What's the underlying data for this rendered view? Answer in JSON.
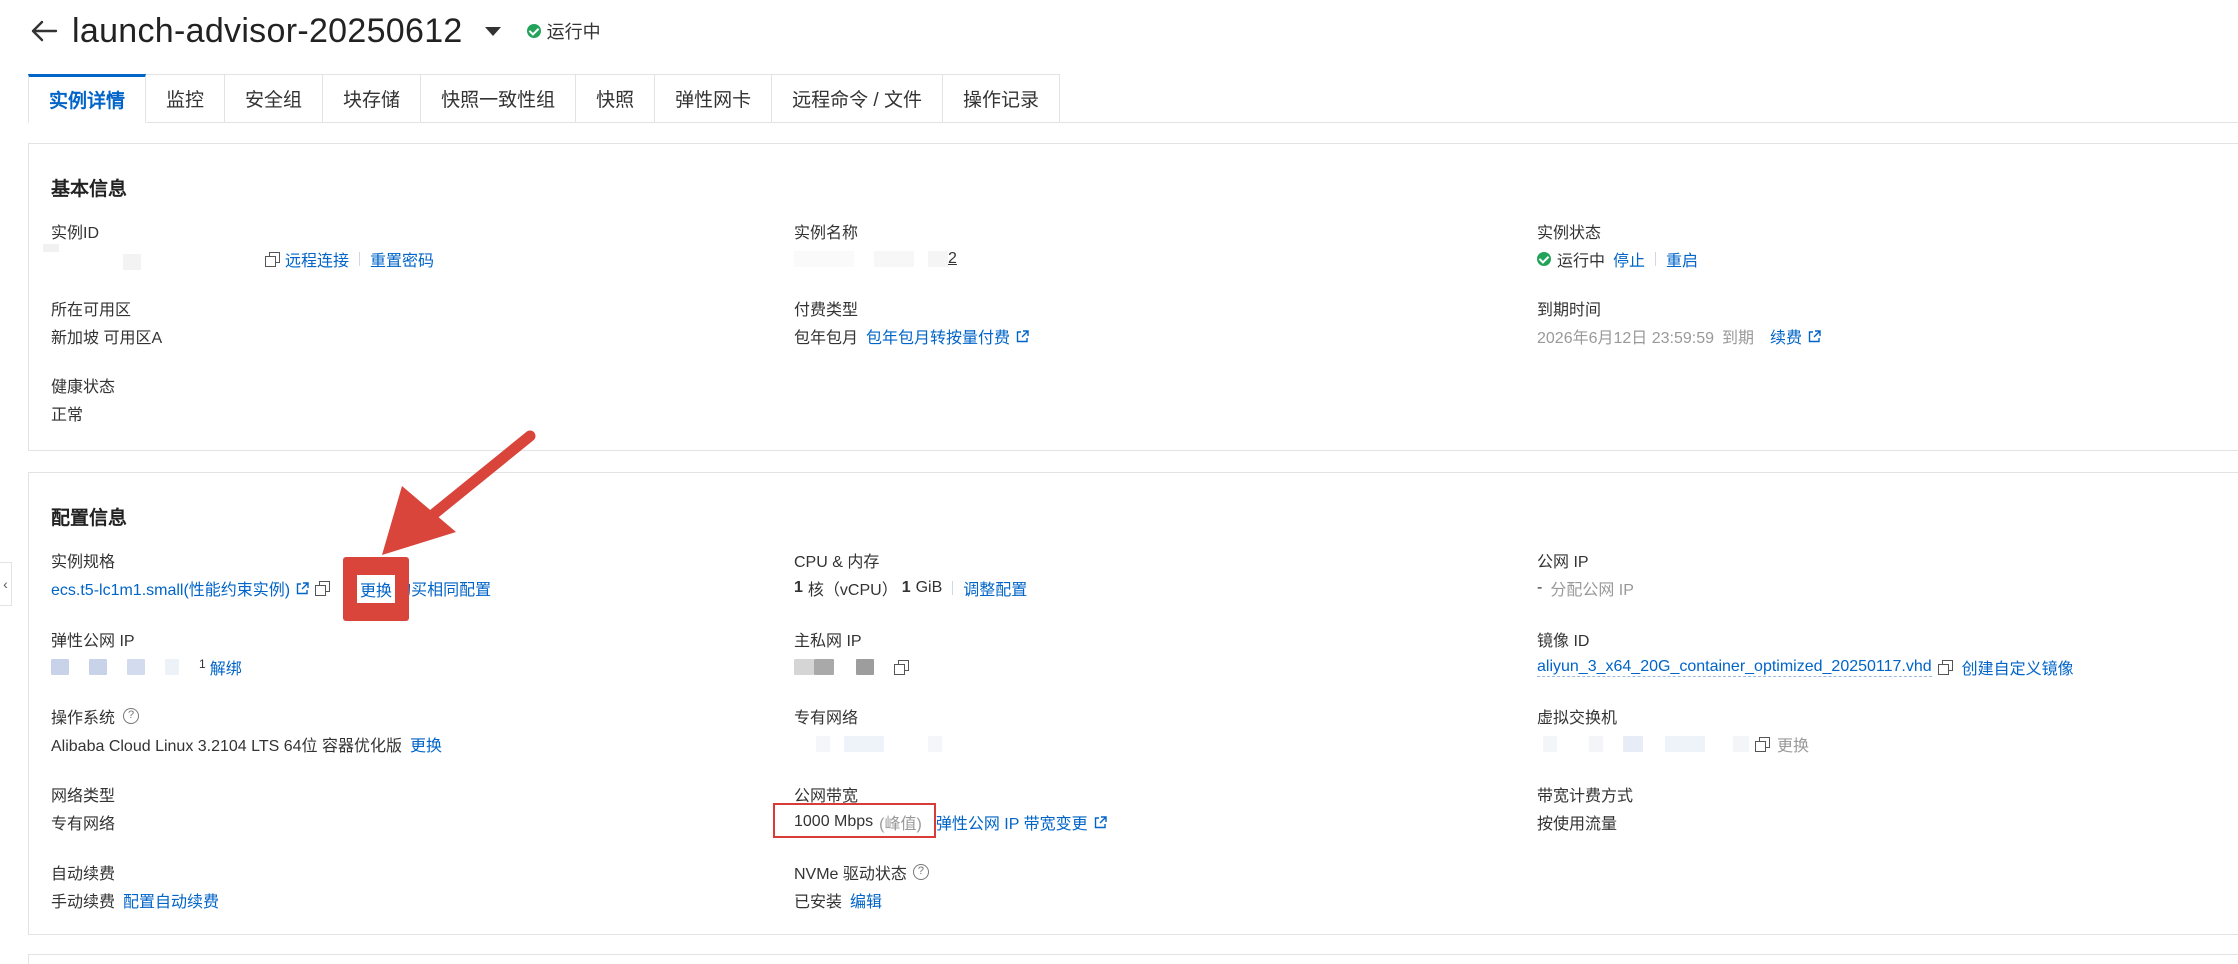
{
  "header": {
    "title": "launch-advisor-20250612",
    "status": "运行中"
  },
  "tabs": [
    "实例详情",
    "监控",
    "安全组",
    "块存储",
    "快照一致性组",
    "快照",
    "弹性网卡",
    "远程命令 / 文件",
    "操作记录"
  ],
  "basic": {
    "title": "基本信息",
    "instance_id_label": "实例ID",
    "remote_connect": "远程连接",
    "reset_password": "重置密码",
    "instance_name_label": "实例名称",
    "instance_name_suffix": "2",
    "instance_status_label": "实例状态",
    "instance_status": "运行中",
    "stop": "停止",
    "restart": "重启",
    "zone_label": "所在可用区",
    "zone": "新加坡 可用区A",
    "billing_label": "付费类型",
    "billing": "包年包月",
    "billing_switch": "包年包月转按量付费",
    "expire_label": "到期时间",
    "expire_time": "2026年6月12日 23:59:59",
    "expire_suffix": "到期",
    "renew": "续费",
    "health_label": "健康状态",
    "health": "正常"
  },
  "config": {
    "title": "配置信息",
    "spec_label": "实例规格",
    "spec": "ecs.t5-lc1m1.small(性能约束实例)",
    "change": "更换",
    "buy_same": "购买相同配置",
    "cpu_label": "CPU & 内存",
    "cpu_num": "1",
    "cpu_unit": "核（vCPU）",
    "mem_num": "1",
    "mem_unit": "GiB",
    "adjust": "调整配置",
    "public_ip_label": "公网 IP",
    "public_ip": "-",
    "assign_ip": "分配公网 IP",
    "eip_label": "弹性公网 IP",
    "eip_suffix": "1",
    "unbind": "解绑",
    "private_ip_label": "主私网 IP",
    "image_label": "镜像 ID",
    "image": "aliyun_3_x64_20G_container_optimized_20250117.vhd",
    "create_image": "创建自定义镜像",
    "os_label": "操作系统",
    "os": "Alibaba Cloud Linux 3.2104 LTS 64位 容器优化版",
    "os_change": "更换",
    "vpc_label": "专有网络",
    "vswitch_label": "虚拟交换机",
    "vswitch_change": "更换",
    "network_type_label": "网络类型",
    "network_type": "专有网络",
    "bandwidth_label": "公网带宽",
    "bandwidth": "1000 Mbps",
    "bandwidth_note": "(峰值)",
    "bandwidth_change": "弹性公网 IP 带宽变更",
    "bw_billing_label": "带宽计费方式",
    "bw_billing": "按使用流量",
    "auto_renew_label": "自动续费",
    "auto_renew": "手动续费",
    "config_auto_renew": "配置自动续费",
    "nvme_label": "NVMe 驱动状态",
    "nvme": "已安装",
    "edit": "编辑"
  },
  "colors": {
    "link": "#0064c8",
    "success": "#23a35a",
    "annotation": "#d9443b"
  }
}
